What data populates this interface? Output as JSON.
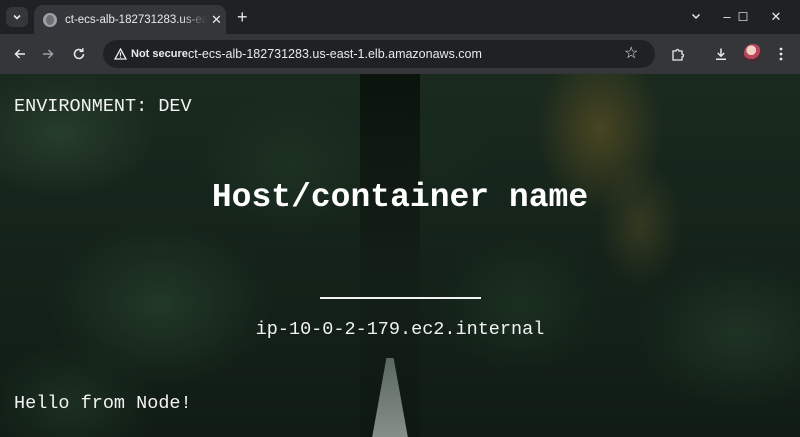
{
  "browser": {
    "tab": {
      "title": "ct-ecs-alb-182731283.us-east-1.elb.amazonaws.com",
      "favicon": "globe-icon",
      "close_icon": "close-icon"
    },
    "tab_search_icon": "chevron-down-icon",
    "new_tab_label": "+",
    "window_controls": {
      "minimize": "–",
      "maximize": "☐",
      "close": "✕"
    },
    "toolbar": {
      "back_icon": "arrow-left-icon",
      "forward_icon": "arrow-right-icon",
      "reload_icon": "reload-icon",
      "security_chip": "Not secure",
      "security_icon": "warning-icon",
      "url": "ct-ecs-alb-182731283.us-east-1.elb.amazonaws.com",
      "bookmark_icon": "star-icon",
      "extensions_icon": "puzzle-icon",
      "download_icon": "download-icon",
      "profile_icon": "avatar",
      "menu_icon": "more-vertical-icon"
    }
  },
  "page": {
    "environment": "ENVIRONMENT: DEV",
    "host_heading": "Host/container name",
    "host_value": "ip-10-0-2-179.ec2.internal",
    "greeting": "Hello from Node!"
  },
  "colors": {
    "chrome_dark": "#202124",
    "chrome_toolbar": "#35363a",
    "text": "#e8eaed",
    "page_text": "#ffffff"
  }
}
